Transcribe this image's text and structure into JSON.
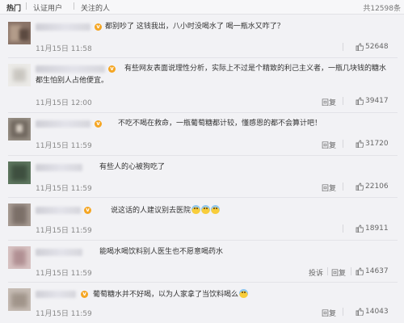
{
  "tabs": {
    "hot": "热门",
    "verified": "认证用户",
    "following": "关注的人",
    "total": "共12598条"
  },
  "actions": {
    "reply": "回复",
    "report": "投诉"
  },
  "comments": [
    {
      "text": "都别吵了 这钱我出，八小时没喝水了 喝一瓶水又咋了？",
      "date": "11月15日 11:58",
      "likes": "52648"
    },
    {
      "text_line1": "有些网友表面说理性分析，实际上不过是个精致的利己主义者，一瓶几块钱的糖水",
      "text_line2": "都生怕别人占他便宜。",
      "date": "11月15日 12:00",
      "likes": "39417"
    },
    {
      "text": "不吃不喝在救命，一瓶葡萄糖都计较，懂感恩的都不会算计吧！",
      "date": "11月15日 11:59",
      "likes": "31720"
    },
    {
      "text": "有些人的心被狗吃了",
      "date": "11月15日 11:59",
      "likes": "22106"
    },
    {
      "text": "说这话的人建议别去医院",
      "date": "11月15日 11:59",
      "likes": "18911"
    },
    {
      "text": "能喝水喝饮料别人医生也不愿意喝药水",
      "date": "11月15日 11:59",
      "likes": "14637"
    },
    {
      "text": "葡萄糖水并不好喝，以为人家拿了当饮料喝么",
      "date": "11月15日 11:59",
      "likes": "14043"
    }
  ],
  "colors": {
    "badge": "#f5a623",
    "emoji": "#f8cd3b",
    "background": "#f2f2f5"
  },
  "icons": {
    "verified_badge": "vip-badge-icon",
    "like": "thumb-up-icon",
    "emoji": "face-emoji-icon"
  }
}
